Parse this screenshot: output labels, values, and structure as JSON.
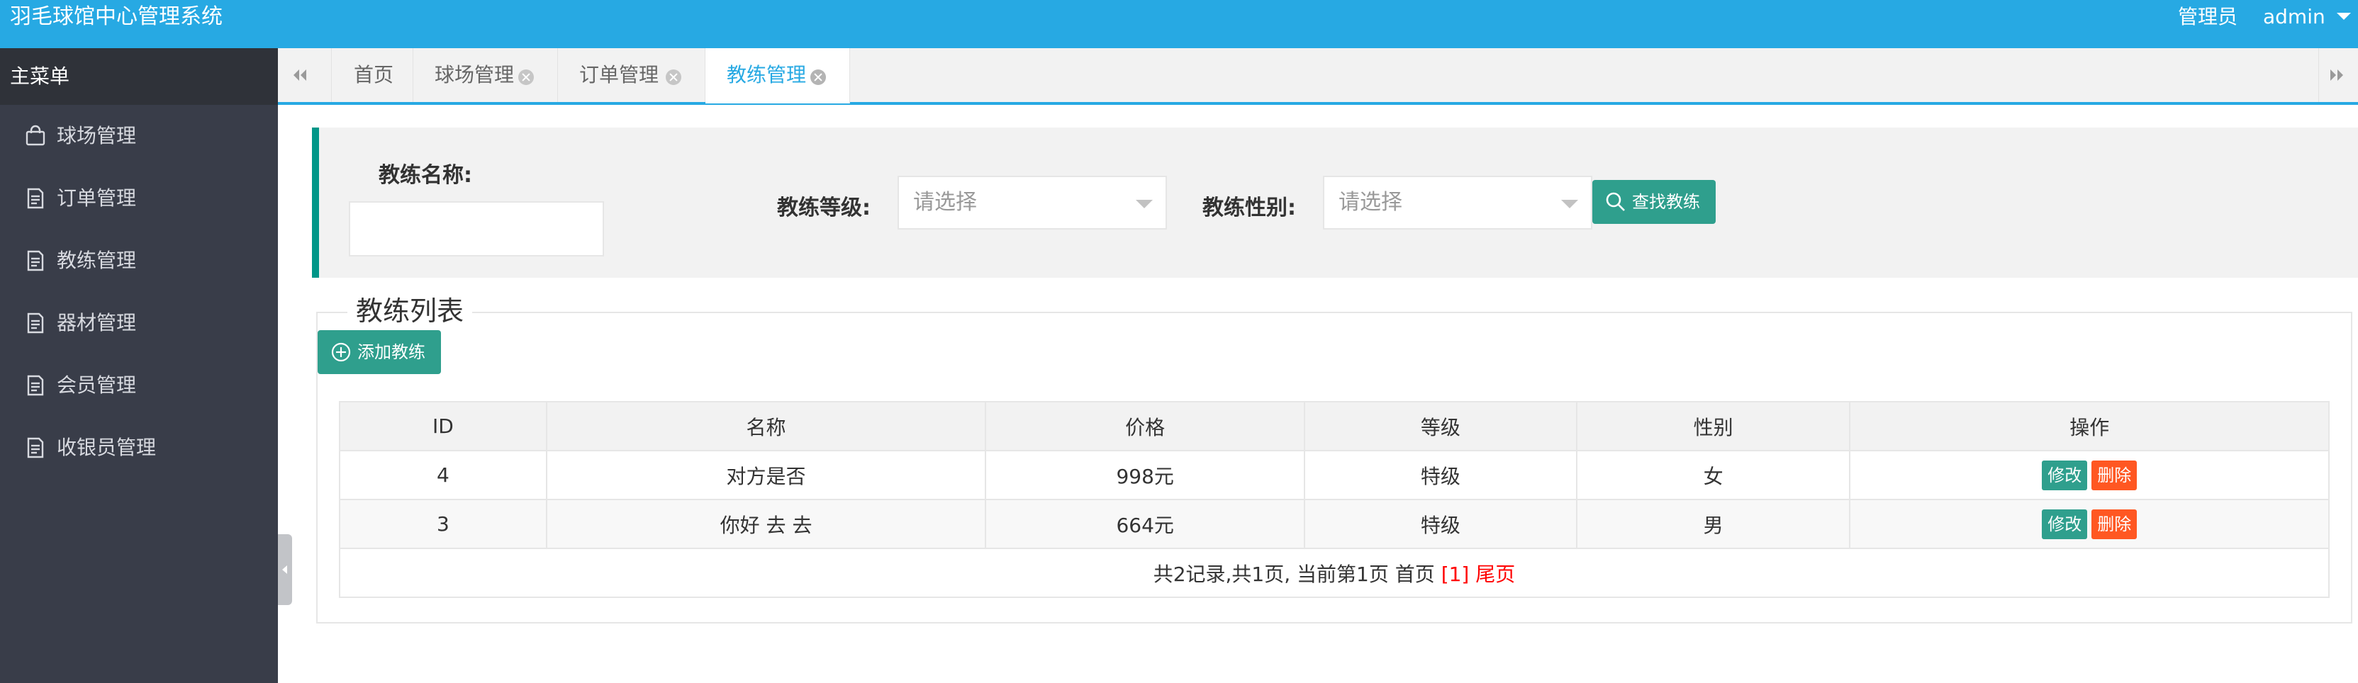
{
  "header": {
    "app_title": "羽毛球馆中心管理系统",
    "role": "管理员",
    "user": "admin"
  },
  "sidebar": {
    "title": "主菜单",
    "items": [
      {
        "label": "球场管理",
        "icon": "shopping-bag-icon"
      },
      {
        "label": "订单管理",
        "icon": "document-icon"
      },
      {
        "label": "教练管理",
        "icon": "document-icon"
      },
      {
        "label": "器材管理",
        "icon": "document-icon"
      },
      {
        "label": "会员管理",
        "icon": "document-icon"
      },
      {
        "label": "收银员管理",
        "icon": "document-icon"
      }
    ]
  },
  "tabs": [
    {
      "label": "首页",
      "closable": false
    },
    {
      "label": "球场管理",
      "closable": true
    },
    {
      "label": "订单管理",
      "closable": true
    },
    {
      "label": "教练管理",
      "closable": true,
      "active": true
    }
  ],
  "search": {
    "name_label": "教练名称:",
    "name_value": "",
    "level_label": "教练等级:",
    "level_selected": "请选择",
    "gender_label": "教练性别:",
    "gender_selected": "请选择",
    "search_button": "查找教练"
  },
  "list": {
    "legend": "教练列表",
    "add_button": "添加教练",
    "columns": [
      "ID",
      "名称",
      "价格",
      "等级",
      "性别",
      "操作"
    ],
    "rows": [
      {
        "id": "4",
        "name": "对方是否",
        "price": "998元",
        "level": "特级",
        "gender": "女"
      },
      {
        "id": "3",
        "name": "你好 去 去",
        "price": "664元",
        "level": "特级",
        "gender": "男"
      }
    ],
    "edit_label": "修改",
    "delete_label": "删除",
    "pager": {
      "summary": "共2记录,共1页, 当前第1页",
      "first": "首页",
      "current": "[1]",
      "last": "尾页"
    }
  },
  "colors": {
    "header_bg": "#27a9e3",
    "sidebar_bg": "#393d49",
    "primary_green": "#2f9f8d",
    "danger": "#ff5722",
    "pager_link": "#ff0000"
  }
}
